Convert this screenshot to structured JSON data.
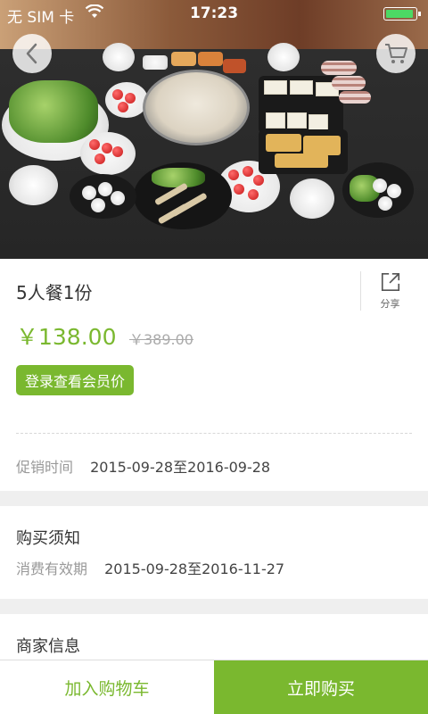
{
  "status_bar": {
    "carrier": "无 SIM 卡",
    "time": "17:23",
    "battery_color": "#4cd964"
  },
  "header": {
    "back_icon": "chevron-left-icon",
    "cart_icon": "shopping-cart-icon"
  },
  "product": {
    "title": "5人餐1份",
    "price": "￥138.00",
    "original_price": "￥389.00",
    "member_price_button": "登录查看会员价",
    "share_label": "分享",
    "share_icon": "share-external-icon",
    "promo_label": "促销时间",
    "promo_period": "2015-09-28至2016-09-28"
  },
  "purchase_notes": {
    "heading": "购买须知",
    "validity_label": "消费有效期",
    "validity_period": "2015-09-28至2016-11-27"
  },
  "merchant": {
    "heading": "商家信息"
  },
  "actions": {
    "add_to_cart": "加入购物车",
    "buy_now": "立即购买"
  },
  "colors": {
    "accent": "#7ab82f",
    "muted_text": "#999999",
    "background": "#efefef"
  }
}
